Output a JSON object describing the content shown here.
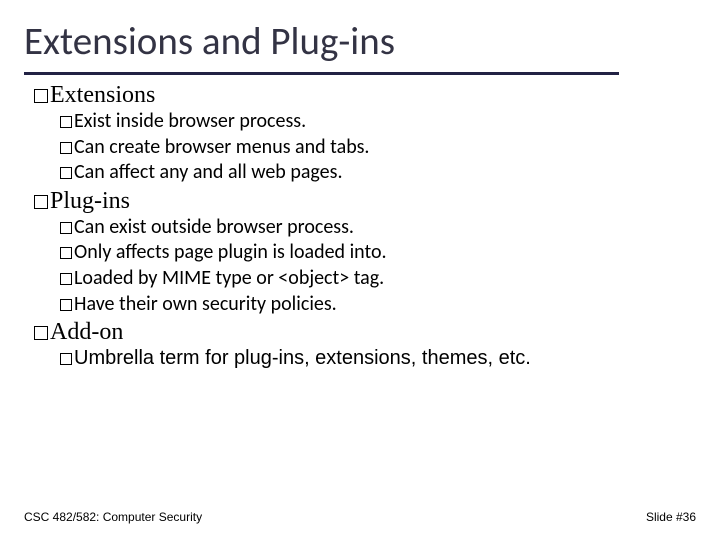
{
  "title": "Extensions and Plug-ins",
  "sections": [
    {
      "heading": "Extensions",
      "items": [
        "Exist inside browser process.",
        "Can create browser menus and tabs.",
        "Can affect any and all web pages."
      ]
    },
    {
      "heading": "Plug-ins",
      "items": [
        "Can exist outside browser process.",
        "Only affects page plugin is loaded into.",
        "Loaded by MIME type or <object> tag.",
        "Have their own security policies."
      ]
    },
    {
      "heading": "Add-on",
      "items": [
        "Umbrella term for plug-ins, extensions, themes, etc."
      ]
    }
  ],
  "footer": {
    "left": "CSC 482/582: Computer Security",
    "right": "Slide #36"
  }
}
